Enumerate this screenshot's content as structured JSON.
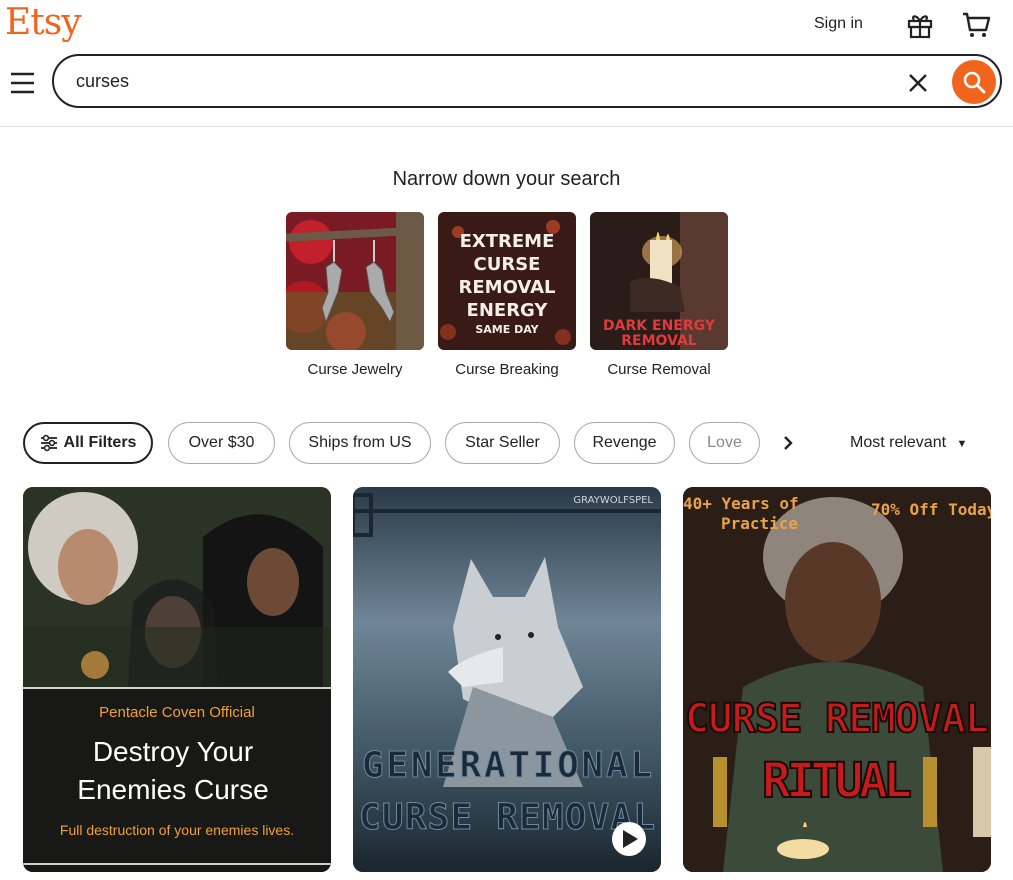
{
  "header": {
    "logo": "Etsy",
    "sign_in": "Sign in",
    "search_value": "curses"
  },
  "narrow": {
    "title": "Narrow down your search",
    "categories": [
      {
        "label": "Curse Jewelry"
      },
      {
        "label": "Curse Breaking",
        "image_text": [
          "EXTREME",
          "CURSE",
          "REMOVAL",
          "ENERGY",
          "SAME DAY"
        ]
      },
      {
        "label": "Curse Removal",
        "image_text": [
          "DARK ENERGY",
          "REMOVAL"
        ]
      }
    ]
  },
  "filters": {
    "all_filters": "All Filters",
    "chips": [
      "Over $30",
      "Ships from US",
      "Star Seller",
      "Revenge",
      "Love"
    ],
    "sort": "Most relevant"
  },
  "listings": [
    {
      "shop": "Pentacle Coven Official",
      "title_line1": "Destroy Your",
      "title_line2": "Enemies Curse",
      "subtitle": "Full destruction of your enemies lives."
    },
    {
      "watermark": "GRAYWOLFSPEL",
      "title_line1": "GENERATIONAL",
      "title_line2": "CURSE REMOVAL"
    },
    {
      "badge_left_1": "40+ Years of",
      "badge_left_2": "Practice",
      "badge_right": "70% Off Today",
      "title_line1": "CURSE REMOVAL",
      "title_line2": "RITUAL"
    }
  ],
  "colors": {
    "brand": "#f1641e",
    "text": "#222222"
  }
}
